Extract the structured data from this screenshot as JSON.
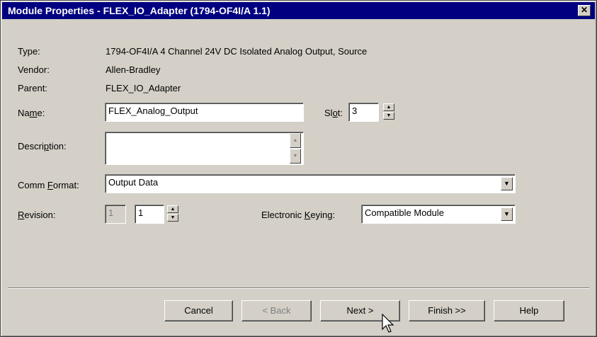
{
  "window": {
    "title": "Module Properties - FLEX_IO_Adapter (1794-OF4I/A 1.1)",
    "close_glyph": "✕",
    "close_icon": "close-icon"
  },
  "info": {
    "type_label": "Type:",
    "type_value": "1794-OF4I/A 4 Channel 24V DC Isolated Analog Output, Source",
    "vendor_label": "Vendor:",
    "vendor_value": "Allen-Bradley",
    "parent_label": "Parent:",
    "parent_value": "FLEX_IO_Adapter"
  },
  "name": {
    "label_pre": "Na",
    "label_u": "m",
    "label_post": "e:",
    "value": "FLEX_Analog_Output"
  },
  "slot": {
    "label_pre": "Sl",
    "label_u": "o",
    "label_post": "t:",
    "value": "3"
  },
  "description": {
    "label_pre": "Descri",
    "label_u": "p",
    "label_post": "tion:",
    "value": ""
  },
  "comm_format": {
    "label_pre": "Comm ",
    "label_u": "F",
    "label_post": "ormat:",
    "value": "Output Data"
  },
  "revision": {
    "label_pre": "",
    "label_u": "R",
    "label_post": "evision:",
    "major": "1",
    "minor": "1"
  },
  "keying": {
    "label_pre": "Electronic ",
    "label_u": "K",
    "label_post": "eying:",
    "value": "Compatible Module"
  },
  "buttons": {
    "cancel": "Cancel",
    "back": "< Back",
    "next": "Next >",
    "finish": "Finish >>",
    "help": "Help"
  }
}
